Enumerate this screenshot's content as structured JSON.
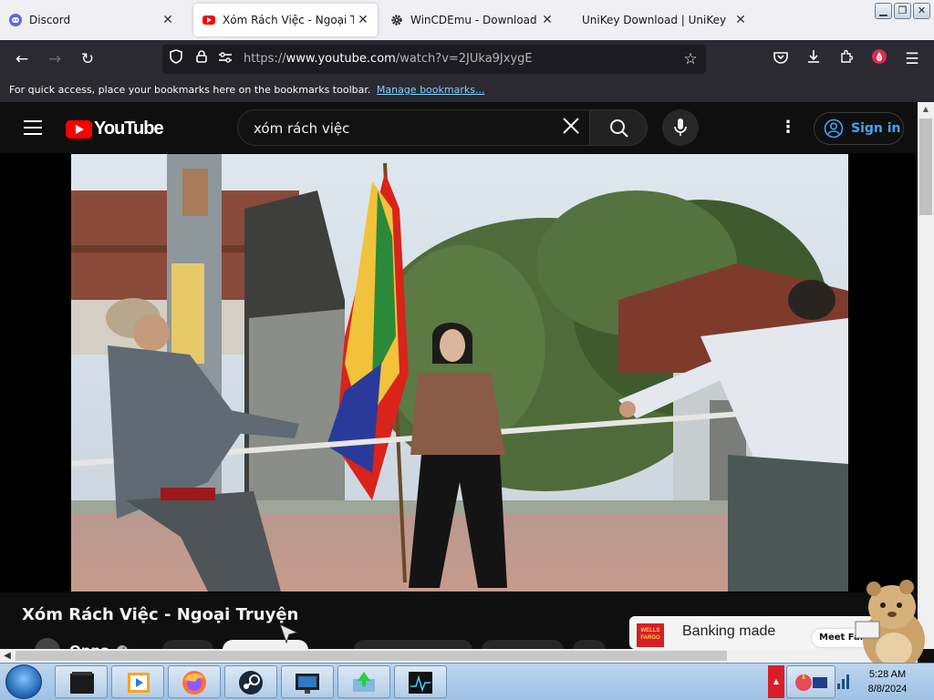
{
  "browser": {
    "tabs": [
      {
        "label": "Discord",
        "icon": "discord-icon",
        "active": false
      },
      {
        "label": "Xóm Rách Việc - Ngoại Truyện",
        "icon": "youtube-icon",
        "active": true
      },
      {
        "label": "WinCDEmu - Download",
        "icon": "gear-icon",
        "active": false
      },
      {
        "label": "UniKey Download | UniKey",
        "icon": "",
        "active": false
      }
    ],
    "tab_close_glyph": "✕",
    "url": {
      "prefix": "https://",
      "host": "www.youtube.com",
      "path": "/watch?v=2JUka9JxygE"
    },
    "bookmarks_bar": {
      "message": "For quick access, place your bookmarks here on the bookmarks toolbar.",
      "link": "Manage bookmarks..."
    },
    "pocket_badge": "0"
  },
  "youtube": {
    "logo_text": "YouTube",
    "search_query": "xóm rách việc",
    "sign_in_label": "Sign in",
    "video": {
      "title": "Xóm Rách Việc - Ngoại Truyện",
      "channel": "Oppa"
    },
    "ad": {
      "brand": "WELLS FARGO",
      "text": "Banking made",
      "cta": "Meet Farg"
    }
  },
  "taskbar": {
    "clock_time": "5:28 AM",
    "clock_date": "8/8/2024",
    "icons": [
      "media-player-icon",
      "video-player-icon",
      "firefox-icon",
      "steam-icon",
      "monitor-icon",
      "download-manager-icon",
      "performance-monitor-icon"
    ]
  },
  "colors": {
    "youtube_red": "#ff0000",
    "link_blue": "#3ea6ff",
    "firefox_toolbar": "#2b2a33",
    "youtube_bg": "#0f0f0f"
  }
}
